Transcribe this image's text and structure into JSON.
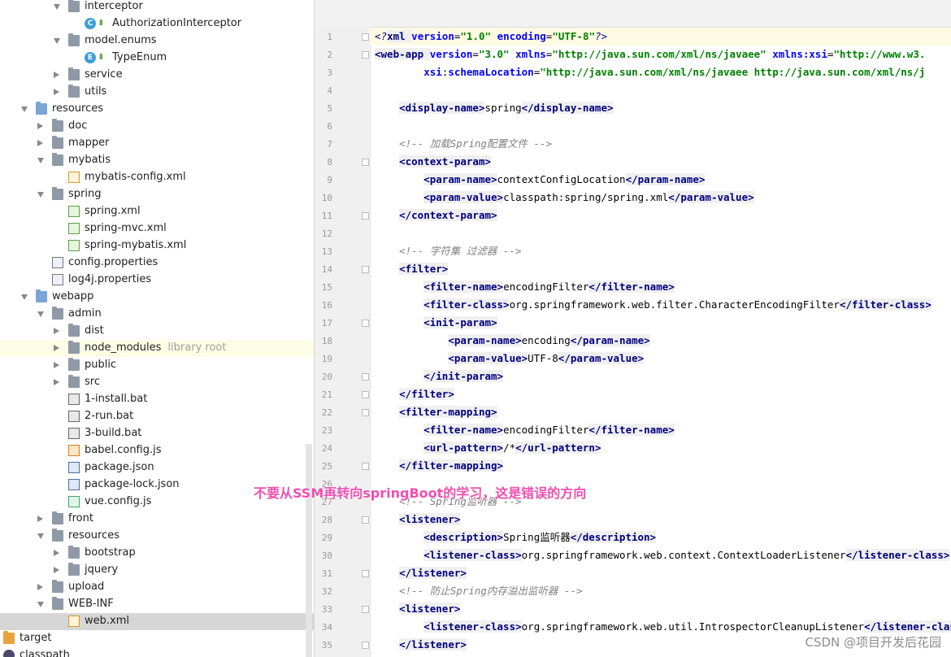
{
  "tree": {
    "rows": [
      {
        "label": "interceptor",
        "depth": 3,
        "state": "open",
        "icon": "folder-icon"
      },
      {
        "label": "AuthorizationInterceptor",
        "depth": 4,
        "state": "leaf",
        "icon": "class-icon",
        "iconText": "C"
      },
      {
        "label": "model.enums",
        "depth": 3,
        "state": "open",
        "icon": "folder-icon"
      },
      {
        "label": "TypeEnum",
        "depth": 4,
        "state": "leaf",
        "icon": "enum-icon",
        "iconText": "E"
      },
      {
        "label": "service",
        "depth": 3,
        "state": "closed",
        "icon": "folder-icon"
      },
      {
        "label": "utils",
        "depth": 3,
        "state": "closed",
        "icon": "folder-icon"
      },
      {
        "label": "resources",
        "depth": 1,
        "state": "open",
        "icon": "resources-folder-icon"
      },
      {
        "label": "doc",
        "depth": 2,
        "state": "closed",
        "icon": "folder-icon"
      },
      {
        "label": "mapper",
        "depth": 2,
        "state": "closed",
        "icon": "folder-icon"
      },
      {
        "label": "mybatis",
        "depth": 2,
        "state": "open",
        "icon": "folder-icon"
      },
      {
        "label": "mybatis-config.xml",
        "depth": 3,
        "state": "leaf",
        "icon": "xml-file-icon"
      },
      {
        "label": "spring",
        "depth": 2,
        "state": "open",
        "icon": "folder-icon"
      },
      {
        "label": "spring.xml",
        "depth": 3,
        "state": "leaf",
        "icon": "spring-xml-icon"
      },
      {
        "label": "spring-mvc.xml",
        "depth": 3,
        "state": "leaf",
        "icon": "spring-xml-icon"
      },
      {
        "label": "spring-mybatis.xml",
        "depth": 3,
        "state": "leaf",
        "icon": "spring-xml-icon"
      },
      {
        "label": "config.properties",
        "depth": 2,
        "state": "leaf",
        "icon": "properties-file-icon"
      },
      {
        "label": "log4j.properties",
        "depth": 2,
        "state": "leaf",
        "icon": "properties-file-icon"
      },
      {
        "label": "webapp",
        "depth": 1,
        "state": "open",
        "icon": "web-folder-icon"
      },
      {
        "label": "admin",
        "depth": 2,
        "state": "open",
        "icon": "folder-icon"
      },
      {
        "label": "dist",
        "depth": 3,
        "state": "closed",
        "icon": "folder-icon"
      },
      {
        "label": "node_modules",
        "depth": 3,
        "state": "closed",
        "icon": "folder-icon",
        "extra": "library root",
        "highlight": true
      },
      {
        "label": "public",
        "depth": 3,
        "state": "closed",
        "icon": "folder-icon"
      },
      {
        "label": "src",
        "depth": 3,
        "state": "closed",
        "icon": "folder-icon"
      },
      {
        "label": "1-install.bat",
        "depth": 3,
        "state": "leaf",
        "icon": "bat-file-icon"
      },
      {
        "label": "2-run.bat",
        "depth": 3,
        "state": "leaf",
        "icon": "bat-file-icon"
      },
      {
        "label": "3-build.bat",
        "depth": 3,
        "state": "leaf",
        "icon": "bat-file-icon"
      },
      {
        "label": "babel.config.js",
        "depth": 3,
        "state": "leaf",
        "icon": "js-file-icon"
      },
      {
        "label": "package.json",
        "depth": 3,
        "state": "leaf",
        "icon": "json-file-icon"
      },
      {
        "label": "package-lock.json",
        "depth": 3,
        "state": "leaf",
        "icon": "json-file-icon"
      },
      {
        "label": "vue.config.js",
        "depth": 3,
        "state": "leaf",
        "icon": "vue-file-icon"
      },
      {
        "label": "front",
        "depth": 2,
        "state": "closed",
        "icon": "folder-icon"
      },
      {
        "label": "resources",
        "depth": 2,
        "state": "open",
        "icon": "folder-icon"
      },
      {
        "label": "bootstrap",
        "depth": 3,
        "state": "closed",
        "icon": "folder-icon"
      },
      {
        "label": "jquery",
        "depth": 3,
        "state": "closed",
        "icon": "folder-icon"
      },
      {
        "label": "upload",
        "depth": 2,
        "state": "closed",
        "icon": "folder-icon"
      },
      {
        "label": "WEB-INF",
        "depth": 2,
        "state": "open",
        "icon": "folder-icon"
      },
      {
        "label": "web.xml",
        "depth": 3,
        "state": "leaf",
        "icon": "xml-file-icon",
        "selected": true
      },
      {
        "label": "target",
        "depth": 0,
        "state": "leaf",
        "icon": "target-folder-icon"
      },
      {
        "label": "classpath",
        "depth": 0,
        "state": "leaf",
        "icon": "classpath-icon"
      }
    ]
  },
  "editor": {
    "lines": [
      {
        "n": "1",
        "fold": true,
        "current": true,
        "segs": [
          [
            "pi",
            "<?"
          ],
          [
            "tg",
            "xml "
          ],
          [
            "at",
            "version"
          ],
          [
            "tx",
            "="
          ],
          [
            "av",
            "\"1.0\""
          ],
          [
            "tx",
            " "
          ],
          [
            "at",
            "encoding"
          ],
          [
            "tx",
            "="
          ],
          [
            "av",
            "\"UTF-8\""
          ],
          [
            "pi",
            "?>"
          ]
        ]
      },
      {
        "n": "2",
        "fold": true,
        "segs": [
          [
            "tg",
            "<web-app "
          ],
          [
            "at",
            "version"
          ],
          [
            "tx",
            "="
          ],
          [
            "av",
            "\"3.0\""
          ],
          [
            "tx",
            " "
          ],
          [
            "at",
            "xmlns"
          ],
          [
            "tx",
            "="
          ],
          [
            "av",
            "\"http://java.sun.com/xml/ns/javaee\""
          ],
          [
            "tx",
            " "
          ],
          [
            "at",
            "xmlns:xsi"
          ],
          [
            "tx",
            "="
          ],
          [
            "av",
            "\"http://www.w3."
          ]
        ]
      },
      {
        "n": "3",
        "segs": [
          [
            "tx",
            "        "
          ],
          [
            "at",
            "xsi"
          ],
          [
            "tx",
            ":"
          ],
          [
            "at",
            "schemaLocation"
          ],
          [
            "tx",
            "="
          ],
          [
            "av",
            "\"http://java.sun.com/xml/ns/javaee http://java.sun.com/xml/ns/j"
          ]
        ]
      },
      {
        "n": "4",
        "segs": []
      },
      {
        "n": "5",
        "segs": [
          [
            "tx",
            "    "
          ],
          [
            "tg",
            "<display-name>"
          ],
          [
            "tx",
            "spring"
          ],
          [
            "tg",
            "</display-name>"
          ]
        ]
      },
      {
        "n": "6",
        "segs": []
      },
      {
        "n": "7",
        "segs": [
          [
            "tx",
            "    "
          ],
          [
            "cm",
            "<!-- 加载Spring配置文件 -->"
          ]
        ]
      },
      {
        "n": "8",
        "fold": true,
        "segs": [
          [
            "tx",
            "    "
          ],
          [
            "tg",
            "<context-param>"
          ]
        ]
      },
      {
        "n": "9",
        "segs": [
          [
            "tx",
            "        "
          ],
          [
            "tg",
            "<param-name>"
          ],
          [
            "tx",
            "contextConfigLocation"
          ],
          [
            "tg",
            "</param-name>"
          ]
        ]
      },
      {
        "n": "10",
        "segs": [
          [
            "tx",
            "        "
          ],
          [
            "tg",
            "<param-value>"
          ],
          [
            "tx",
            "classpath:spring/spring.xml"
          ],
          [
            "tg",
            "</param-value>"
          ]
        ]
      },
      {
        "n": "11",
        "fold": true,
        "segs": [
          [
            "tx",
            "    "
          ],
          [
            "tg",
            "</context-param>"
          ]
        ]
      },
      {
        "n": "12",
        "segs": []
      },
      {
        "n": "13",
        "segs": [
          [
            "tx",
            "    "
          ],
          [
            "cm",
            "<!-- 字符集 过滤器 -->"
          ]
        ]
      },
      {
        "n": "14",
        "fold": true,
        "segs": [
          [
            "tx",
            "    "
          ],
          [
            "tg",
            "<filter>"
          ]
        ]
      },
      {
        "n": "15",
        "segs": [
          [
            "tx",
            "        "
          ],
          [
            "tg",
            "<filter-name>"
          ],
          [
            "tx",
            "encodingFilter"
          ],
          [
            "tg",
            "</filter-name>"
          ]
        ]
      },
      {
        "n": "16",
        "segs": [
          [
            "tx",
            "        "
          ],
          [
            "tg",
            "<filter-class>"
          ],
          [
            "tx",
            "org.springframework.web.filter.CharacterEncodingFilter"
          ],
          [
            "tg",
            "</filter-class>"
          ]
        ]
      },
      {
        "n": "17",
        "fold": true,
        "segs": [
          [
            "tx",
            "        "
          ],
          [
            "tg",
            "<init-param>"
          ]
        ]
      },
      {
        "n": "18",
        "segs": [
          [
            "tx",
            "            "
          ],
          [
            "tg",
            "<param-name>"
          ],
          [
            "tx",
            "encoding"
          ],
          [
            "tg",
            "</param-name>"
          ]
        ]
      },
      {
        "n": "19",
        "segs": [
          [
            "tx",
            "            "
          ],
          [
            "tg",
            "<param-value>"
          ],
          [
            "tx",
            "UTF-8"
          ],
          [
            "tg",
            "</param-value>"
          ]
        ]
      },
      {
        "n": "20",
        "fold": true,
        "segs": [
          [
            "tx",
            "        "
          ],
          [
            "tg",
            "</init-param>"
          ]
        ]
      },
      {
        "n": "21",
        "fold": true,
        "segs": [
          [
            "tx",
            "    "
          ],
          [
            "tg",
            "</filter>"
          ]
        ]
      },
      {
        "n": "22",
        "fold": true,
        "segs": [
          [
            "tx",
            "    "
          ],
          [
            "tg",
            "<filter-mapping>"
          ]
        ]
      },
      {
        "n": "23",
        "segs": [
          [
            "tx",
            "        "
          ],
          [
            "tg",
            "<filter-name>"
          ],
          [
            "tx",
            "encodingFilter"
          ],
          [
            "tg",
            "</filter-name>"
          ]
        ]
      },
      {
        "n": "24",
        "segs": [
          [
            "tx",
            "        "
          ],
          [
            "tg",
            "<url-pattern>"
          ],
          [
            "tx",
            "/*"
          ],
          [
            "tg",
            "</url-pattern>"
          ]
        ]
      },
      {
        "n": "25",
        "fold": true,
        "segs": [
          [
            "tx",
            "    "
          ],
          [
            "tg",
            "</filter-mapping>"
          ]
        ]
      },
      {
        "n": "26",
        "segs": []
      },
      {
        "n": "27",
        "segs": [
          [
            "tx",
            "    "
          ],
          [
            "cm",
            "<!-- Spring监听器 -->"
          ]
        ]
      },
      {
        "n": "28",
        "fold": true,
        "segs": [
          [
            "tx",
            "    "
          ],
          [
            "tg",
            "<listener>"
          ]
        ]
      },
      {
        "n": "29",
        "segs": [
          [
            "tx",
            "        "
          ],
          [
            "tg",
            "<description>"
          ],
          [
            "tx",
            "Spring监听器"
          ],
          [
            "tg",
            "</description>"
          ]
        ]
      },
      {
        "n": "30",
        "segs": [
          [
            "tx",
            "        "
          ],
          [
            "tg",
            "<listener-class>"
          ],
          [
            "tx",
            "org.springframework.web.context.ContextLoaderListener"
          ],
          [
            "tg",
            "</listener-class>"
          ]
        ]
      },
      {
        "n": "31",
        "fold": true,
        "segs": [
          [
            "tx",
            "    "
          ],
          [
            "tg",
            "</listener>"
          ]
        ]
      },
      {
        "n": "32",
        "segs": [
          [
            "tx",
            "    "
          ],
          [
            "cm",
            "<!-- 防止Spring内存溢出监听器 -->"
          ]
        ]
      },
      {
        "n": "33",
        "fold": true,
        "segs": [
          [
            "tx",
            "    "
          ],
          [
            "tg",
            "<listener>"
          ]
        ]
      },
      {
        "n": "34",
        "segs": [
          [
            "tx",
            "        "
          ],
          [
            "tg",
            "<listener-class>"
          ],
          [
            "tx",
            "org.springframework.web.util.IntrospectorCleanupListener"
          ],
          [
            "tg",
            "</listener-class>"
          ]
        ]
      },
      {
        "n": "35",
        "fold": true,
        "segs": [
          [
            "tx",
            "    "
          ],
          [
            "tg",
            "</listener>"
          ]
        ]
      }
    ]
  },
  "overlay_text": "不要从SSM再转向springBoot的学习，这是错误的方向",
  "watermark": "CSDN @项目开发后花园"
}
